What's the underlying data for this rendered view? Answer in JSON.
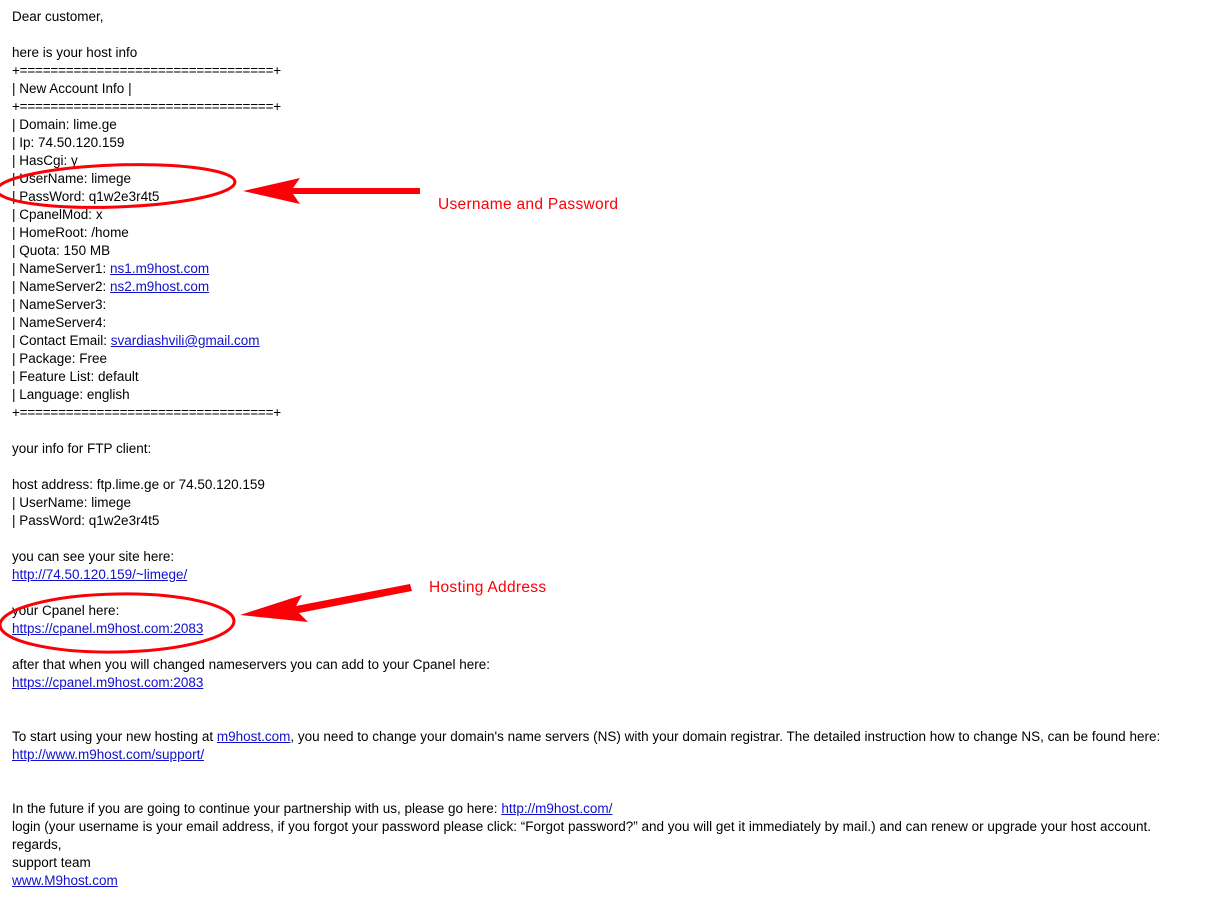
{
  "email": {
    "greeting": "Dear customer,",
    "intro": "here is your host info",
    "box": {
      "rule": "+=================================+",
      "title": "| New Account Info |",
      "rows": [
        {
          "label": "| Domain: ",
          "value": "lime.ge"
        },
        {
          "label": "| Ip: ",
          "value": "74.50.120.159"
        },
        {
          "label": "| HasCgi: ",
          "value": "y"
        },
        {
          "label": "| UserName: ",
          "value": "limege"
        },
        {
          "label": "| PassWord: ",
          "value": "q1w2e3r4t5"
        },
        {
          "label": "| CpanelMod: ",
          "value": "x"
        },
        {
          "label": "| HomeRoot: ",
          "value": "/home"
        },
        {
          "label": "| Quota: ",
          "value": "150 MB"
        },
        {
          "label": "| NameServer1: ",
          "value": "ns1.m9host.com",
          "is_link": true
        },
        {
          "label": "| NameServer2: ",
          "value": "ns2.m9host.com",
          "is_link": true
        },
        {
          "label": "| NameServer3:",
          "value": ""
        },
        {
          "label": "| NameServer4:",
          "value": ""
        },
        {
          "label": "| Contact Email: ",
          "value": "svardiashvili@gmail.com",
          "is_link": true
        },
        {
          "label": "| Package: ",
          "value": "Free"
        },
        {
          "label": "| Feature List: ",
          "value": "default"
        },
        {
          "label": "| Language: ",
          "value": "english"
        }
      ]
    },
    "ftp": {
      "heading": "your info for FTP client:",
      "host_address": "host address: ftp.lime.ge or 74.50.120.159",
      "username": "| UserName: limege",
      "password": "| PassWord: q1w2e3r4t5"
    },
    "site": {
      "heading": "you can see your site here:",
      "url": "http://74.50.120.159/~limege/"
    },
    "cpanel": {
      "heading": "your Cpanel here:",
      "url": "https://cpanel.m9host.com:2083"
    },
    "nameservers_note": {
      "text": "after that when you will changed nameservers you can add to your Cpanel here:",
      "url": "https://cpanel.m9host.com:2083"
    },
    "start_paragraph": {
      "prefix": "To start using your new hosting at ",
      "link": "m9host.com",
      "suffix": ", you need to change your domain's name servers (NS) with your domain registrar. The detailed instruction how to change NS, can be found here:",
      "support_url": "http://www.m9host.com/support/"
    },
    "future_paragraph": {
      "prefix": "In the future if you are going to continue your partnership with us, please go here: ",
      "link": "http://m9host.com/",
      "line2": "login (your username is your email address, if you forgot your password please click: “Forgot password?” and you will get it immediately by mail.) and can renew or upgrade your host account."
    },
    "signoff": {
      "regards": "regards,",
      "team": "support team",
      "site": "www.M9host.com"
    }
  },
  "annotations": {
    "color": "#fb0007",
    "credentials_label": "Username and Password",
    "hosting_label": "Hosting Address"
  }
}
